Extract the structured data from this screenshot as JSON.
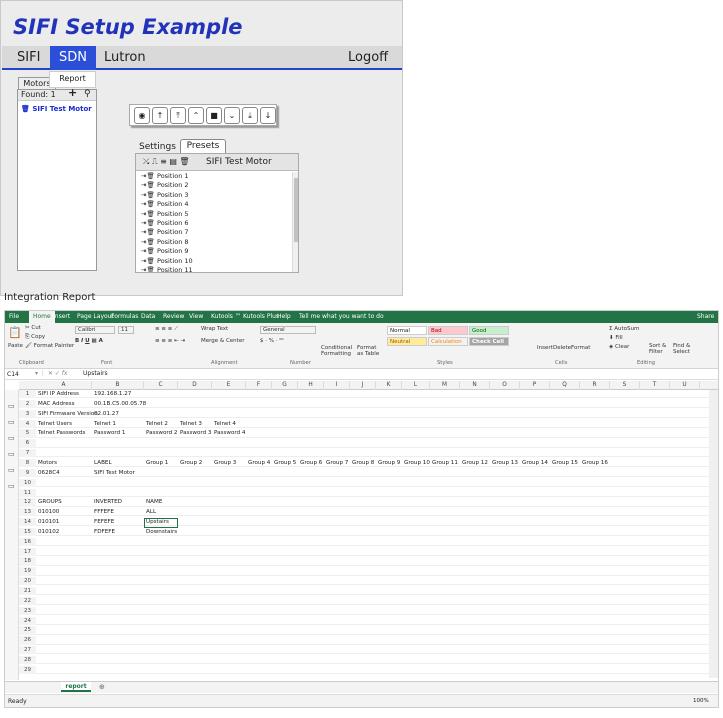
{
  "app": {
    "title": "SIFI Setup Example",
    "nav": [
      "SIFI",
      "SDN",
      "Lutron"
    ],
    "logoff": "Logoff",
    "report": "Report",
    "motors_tab": "Motors",
    "found": "Found: 1",
    "motor": "SIFI Test Motor",
    "toolbar": [
      "◉",
      "↑",
      "⤒",
      "⌃",
      "■",
      "⌄",
      "⤓",
      "↓"
    ],
    "tabs": {
      "settings": "Settings",
      "presets": "Presets"
    },
    "presets_header_icons": "⤯ ⎍ ≡ ▤ 🗑",
    "presets_title": "SIFI Test Motor",
    "presets": [
      "Position 1",
      "Position 2",
      "Position 3",
      "Position 4",
      "Position 5",
      "Position 6",
      "Position 7",
      "Position 8",
      "Position 9",
      "Position 10",
      "Position 11",
      "Position 12"
    ]
  },
  "integration_report": "Integration Report",
  "excel": {
    "menu": [
      "File",
      "Home",
      "Insert",
      "Page Layout",
      "Formulas",
      "Data",
      "Review",
      "View",
      "Kutools ™",
      "Kutools Plus",
      "Help",
      "Tell me what you want to do",
      "Share"
    ],
    "ribbon": {
      "cut": "Cut",
      "copy": "Copy",
      "format_painter": "Format Painter",
      "paste": "Paste",
      "font": "Calibri",
      "size": "11",
      "wrap": "Wrap Text",
      "merge": "Merge & Center",
      "number_format": "General",
      "cond": "Conditional Formatting",
      "format_table": "Format as Table",
      "normal": "Normal",
      "bad": "Bad",
      "good": "Good",
      "neutral": "Neutral",
      "calculation": "Calculation",
      "check_cell": "Check Cell",
      "insert": "Insert",
      "delete": "Delete",
      "format": "Format",
      "autosum": "AutoSum",
      "fill": "Fill",
      "clear": "Clear",
      "sort": "Sort & Filter",
      "find": "Find & Select",
      "groups": [
        "Clipboard",
        "Font",
        "Alignment",
        "Number",
        "Styles",
        "Cells",
        "Editing"
      ]
    },
    "name_box": "C14",
    "formula": "Upstairs",
    "columns": [
      "A",
      "B",
      "C",
      "D",
      "E",
      "F",
      "G",
      "H",
      "I",
      "J",
      "K",
      "L",
      "M",
      "N",
      "O",
      "P",
      "Q",
      "R",
      "S",
      "T",
      "U"
    ],
    "rows": [
      [
        "SIFI IP Address",
        "192.168.1.27"
      ],
      [
        "MAC Address",
        "00.1B.C5.00.05.78"
      ],
      [
        "SIFI Firmware Version",
        "02.01.27"
      ],
      [
        "Telnet Users",
        "Telnet 1",
        "Telnet 2",
        "Telnet 3",
        "Telnet 4"
      ],
      [
        "Telnet Passwords",
        "Password 1",
        "Password 2",
        "Password 3",
        "Password 4"
      ],
      [],
      [],
      [
        "Motors",
        "LABEL",
        "Group 1",
        "Group 2",
        "Group 3",
        "Group 4",
        "Group 5",
        "Group 6",
        "Group 7",
        "Group 8",
        "Group 9",
        "Group 10",
        "Group 11",
        "Group 12",
        "Group 13",
        "Group 14",
        "Group 15",
        "Group 16"
      ],
      [
        "0628C4",
        "SIFI Test Motor"
      ],
      [],
      [],
      [
        "GROUPS",
        "INVERTED",
        "NAME"
      ],
      [
        "010100",
        "FFFEFE",
        "ALL"
      ],
      [
        "010101",
        "FEFEFE",
        "Upstairs"
      ],
      [
        "010102",
        "FDFEFE",
        "Downstairs"
      ],
      [],
      [],
      [],
      [],
      [],
      [],
      [],
      [],
      [],
      [],
      [],
      [],
      [],
      []
    ],
    "sheet": "report",
    "status": "Ready",
    "zoom": "100%"
  }
}
